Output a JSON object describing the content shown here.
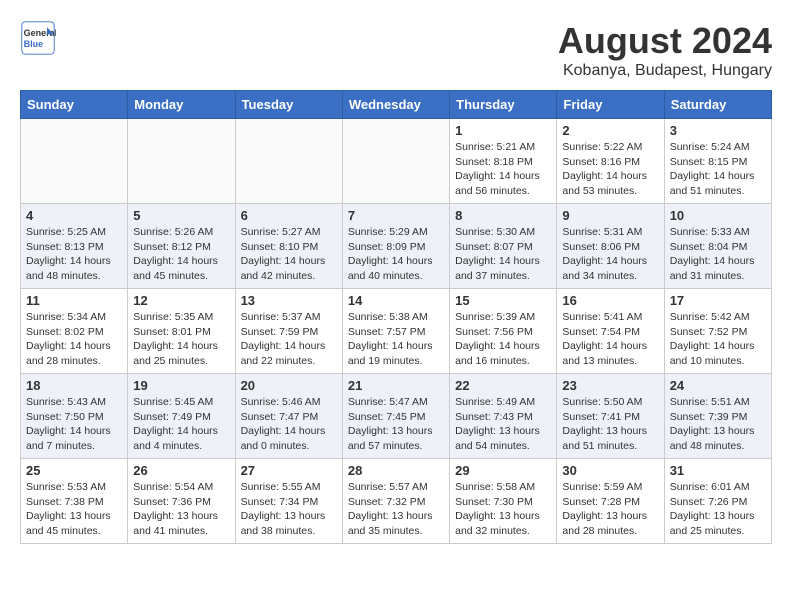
{
  "header": {
    "logo_line1": "General",
    "logo_line2": "Blue",
    "main_title": "August 2024",
    "subtitle": "Kobanya, Budapest, Hungary"
  },
  "columns": [
    "Sunday",
    "Monday",
    "Tuesday",
    "Wednesday",
    "Thursday",
    "Friday",
    "Saturday"
  ],
  "weeks": [
    {
      "days": [
        {
          "num": "",
          "info": ""
        },
        {
          "num": "",
          "info": ""
        },
        {
          "num": "",
          "info": ""
        },
        {
          "num": "",
          "info": ""
        },
        {
          "num": "1",
          "info": "Sunrise: 5:21 AM\nSunset: 8:18 PM\nDaylight: 14 hours\nand 56 minutes."
        },
        {
          "num": "2",
          "info": "Sunrise: 5:22 AM\nSunset: 8:16 PM\nDaylight: 14 hours\nand 53 minutes."
        },
        {
          "num": "3",
          "info": "Sunrise: 5:24 AM\nSunset: 8:15 PM\nDaylight: 14 hours\nand 51 minutes."
        }
      ]
    },
    {
      "days": [
        {
          "num": "4",
          "info": "Sunrise: 5:25 AM\nSunset: 8:13 PM\nDaylight: 14 hours\nand 48 minutes."
        },
        {
          "num": "5",
          "info": "Sunrise: 5:26 AM\nSunset: 8:12 PM\nDaylight: 14 hours\nand 45 minutes."
        },
        {
          "num": "6",
          "info": "Sunrise: 5:27 AM\nSunset: 8:10 PM\nDaylight: 14 hours\nand 42 minutes."
        },
        {
          "num": "7",
          "info": "Sunrise: 5:29 AM\nSunset: 8:09 PM\nDaylight: 14 hours\nand 40 minutes."
        },
        {
          "num": "8",
          "info": "Sunrise: 5:30 AM\nSunset: 8:07 PM\nDaylight: 14 hours\nand 37 minutes."
        },
        {
          "num": "9",
          "info": "Sunrise: 5:31 AM\nSunset: 8:06 PM\nDaylight: 14 hours\nand 34 minutes."
        },
        {
          "num": "10",
          "info": "Sunrise: 5:33 AM\nSunset: 8:04 PM\nDaylight: 14 hours\nand 31 minutes."
        }
      ]
    },
    {
      "days": [
        {
          "num": "11",
          "info": "Sunrise: 5:34 AM\nSunset: 8:02 PM\nDaylight: 14 hours\nand 28 minutes."
        },
        {
          "num": "12",
          "info": "Sunrise: 5:35 AM\nSunset: 8:01 PM\nDaylight: 14 hours\nand 25 minutes."
        },
        {
          "num": "13",
          "info": "Sunrise: 5:37 AM\nSunset: 7:59 PM\nDaylight: 14 hours\nand 22 minutes."
        },
        {
          "num": "14",
          "info": "Sunrise: 5:38 AM\nSunset: 7:57 PM\nDaylight: 14 hours\nand 19 minutes."
        },
        {
          "num": "15",
          "info": "Sunrise: 5:39 AM\nSunset: 7:56 PM\nDaylight: 14 hours\nand 16 minutes."
        },
        {
          "num": "16",
          "info": "Sunrise: 5:41 AM\nSunset: 7:54 PM\nDaylight: 14 hours\nand 13 minutes."
        },
        {
          "num": "17",
          "info": "Sunrise: 5:42 AM\nSunset: 7:52 PM\nDaylight: 14 hours\nand 10 minutes."
        }
      ]
    },
    {
      "days": [
        {
          "num": "18",
          "info": "Sunrise: 5:43 AM\nSunset: 7:50 PM\nDaylight: 14 hours\nand 7 minutes."
        },
        {
          "num": "19",
          "info": "Sunrise: 5:45 AM\nSunset: 7:49 PM\nDaylight: 14 hours\nand 4 minutes."
        },
        {
          "num": "20",
          "info": "Sunrise: 5:46 AM\nSunset: 7:47 PM\nDaylight: 14 hours\nand 0 minutes."
        },
        {
          "num": "21",
          "info": "Sunrise: 5:47 AM\nSunset: 7:45 PM\nDaylight: 13 hours\nand 57 minutes."
        },
        {
          "num": "22",
          "info": "Sunrise: 5:49 AM\nSunset: 7:43 PM\nDaylight: 13 hours\nand 54 minutes."
        },
        {
          "num": "23",
          "info": "Sunrise: 5:50 AM\nSunset: 7:41 PM\nDaylight: 13 hours\nand 51 minutes."
        },
        {
          "num": "24",
          "info": "Sunrise: 5:51 AM\nSunset: 7:39 PM\nDaylight: 13 hours\nand 48 minutes."
        }
      ]
    },
    {
      "days": [
        {
          "num": "25",
          "info": "Sunrise: 5:53 AM\nSunset: 7:38 PM\nDaylight: 13 hours\nand 45 minutes."
        },
        {
          "num": "26",
          "info": "Sunrise: 5:54 AM\nSunset: 7:36 PM\nDaylight: 13 hours\nand 41 minutes."
        },
        {
          "num": "27",
          "info": "Sunrise: 5:55 AM\nSunset: 7:34 PM\nDaylight: 13 hours\nand 38 minutes."
        },
        {
          "num": "28",
          "info": "Sunrise: 5:57 AM\nSunset: 7:32 PM\nDaylight: 13 hours\nand 35 minutes."
        },
        {
          "num": "29",
          "info": "Sunrise: 5:58 AM\nSunset: 7:30 PM\nDaylight: 13 hours\nand 32 minutes."
        },
        {
          "num": "30",
          "info": "Sunrise: 5:59 AM\nSunset: 7:28 PM\nDaylight: 13 hours\nand 28 minutes."
        },
        {
          "num": "31",
          "info": "Sunrise: 6:01 AM\nSunset: 7:26 PM\nDaylight: 13 hours\nand 25 minutes."
        }
      ]
    }
  ]
}
